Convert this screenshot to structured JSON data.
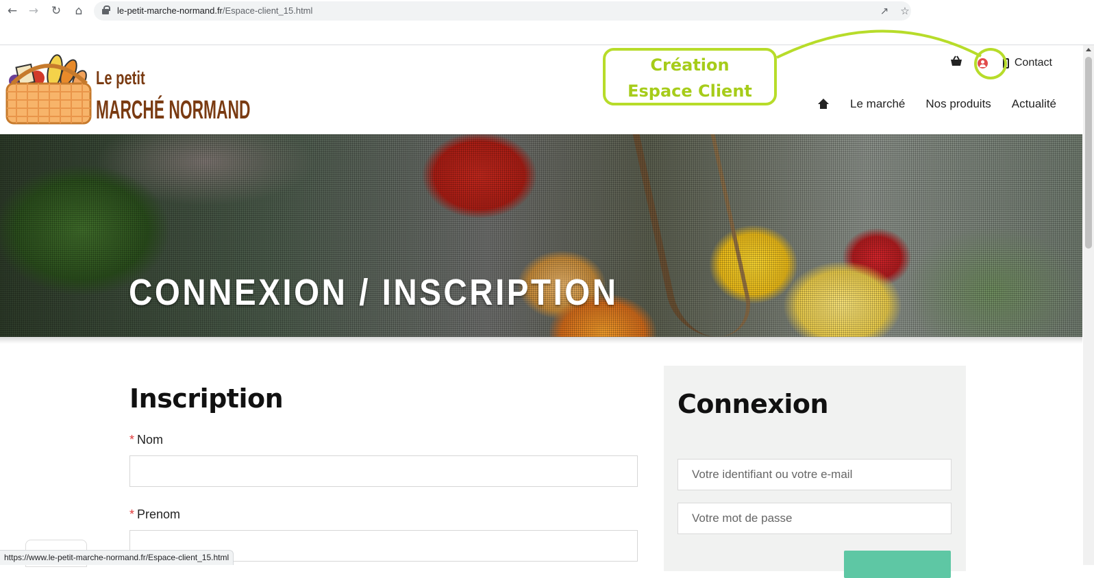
{
  "browser": {
    "url_domain": "le-petit-marche-normand.fr",
    "url_path": "/Espace-client_15.html",
    "status_url": "https://www.le-petit-marche-normand.fr/Espace-client_15.html"
  },
  "site": {
    "logo_line1": "Le petit",
    "logo_line2": "MARCHÉ NORMAND",
    "contact_label": "Contact",
    "nav": [
      "Le marché",
      "Nos produits",
      "Actualité"
    ]
  },
  "annotation": {
    "line1": "Création",
    "line2": "Espace Client"
  },
  "hero": {
    "title": "CONNEXION / INSCRIPTION"
  },
  "inscription": {
    "title": "Inscription",
    "required_mark": "*",
    "fields": [
      {
        "label": "Nom",
        "value": ""
      },
      {
        "label": "Prenom",
        "value": ""
      }
    ]
  },
  "connexion": {
    "title": "Connexion",
    "login_placeholder": "Votre identifiant ou votre e-mail",
    "password_placeholder": "Votre mot de passe"
  },
  "colors": {
    "accent_annotation": "#b7dc2a",
    "logo_brown": "#7a3b12",
    "account_red": "#e24b4b",
    "button_green": "#5ec7a4"
  },
  "icons": [
    "back-icon",
    "forward-icon",
    "reload-icon",
    "home-icon",
    "lock-icon",
    "share-icon",
    "star-icon",
    "basket-icon",
    "account-icon",
    "phone-icon"
  ]
}
